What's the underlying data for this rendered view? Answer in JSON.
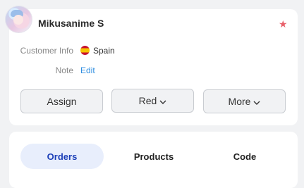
{
  "customer": {
    "name": "Mikusanime S",
    "info_label": "Customer Info",
    "country": "Spain",
    "note_label": "Note",
    "note_action": "Edit"
  },
  "actions": {
    "assign": "Assign",
    "tag": "Red",
    "more": "More"
  },
  "tabs": [
    {
      "label": "Orders",
      "active": true
    },
    {
      "label": "Products",
      "active": false
    },
    {
      "label": "Code",
      "active": false
    }
  ],
  "colors": {
    "star": "#e8606a",
    "link": "#2f8ee0",
    "active_tab_bg": "#e8eefc",
    "active_tab_text": "#1c3fb8"
  },
  "icons": {
    "favorite": "star-icon",
    "country_flag": "spain-flag-icon",
    "dropdown": "chevron-down-icon"
  }
}
